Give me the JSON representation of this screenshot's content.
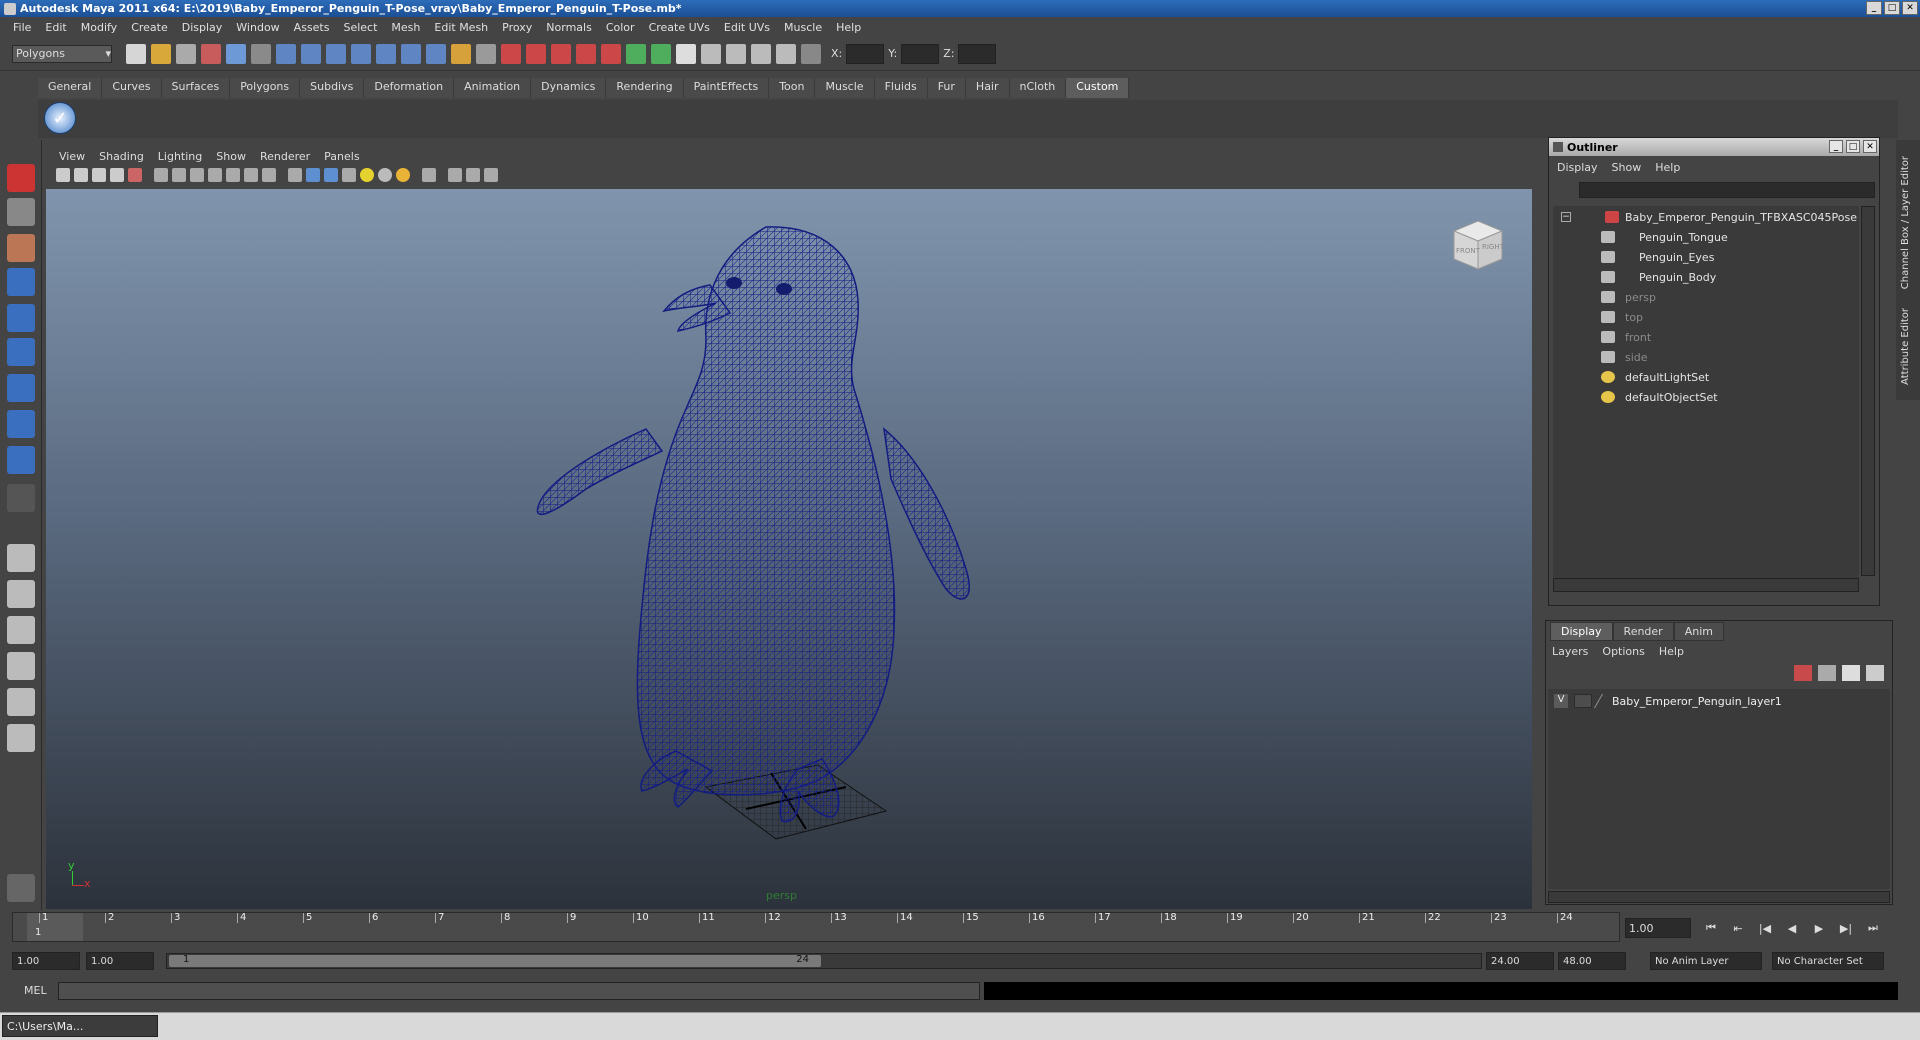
{
  "window": {
    "title": "Autodesk Maya 2011 x64: E:\\2019\\Baby_Emperor_Penguin_T-Pose_vray\\Baby_Emperor_Penguin_T-Pose.mb*"
  },
  "menubar": [
    "File",
    "Edit",
    "Modify",
    "Create",
    "Display",
    "Window",
    "Assets",
    "Select",
    "Mesh",
    "Edit Mesh",
    "Proxy",
    "Normals",
    "Color",
    "Create UVs",
    "Edit UVs",
    "Muscle",
    "Help"
  ],
  "status_line": {
    "mode": "Polygons",
    "coord_labels": {
      "x": "X:",
      "y": "Y:",
      "z": "Z:"
    }
  },
  "shelf_tabs": [
    "General",
    "Curves",
    "Surfaces",
    "Polygons",
    "Subdivs",
    "Deformation",
    "Animation",
    "Dynamics",
    "Rendering",
    "PaintEffects",
    "Toon",
    "Muscle",
    "Fluids",
    "Fur",
    "Hair",
    "nCloth",
    "Custom"
  ],
  "shelf_active": "Custom",
  "viewport": {
    "menu": [
      "View",
      "Shading",
      "Lighting",
      "Show",
      "Renderer",
      "Panels"
    ],
    "camera_label": "persp",
    "viewcube_front": "FRONT",
    "viewcube_right": "RIGHT",
    "axis_y": "y",
    "axis_x": "x"
  },
  "outliner": {
    "title": "Outliner",
    "menu": [
      "Display",
      "Show",
      "Help"
    ],
    "root": "Baby_Emperor_Penguin_TFBXASC045Pose",
    "children": [
      "Penguin_Tongue",
      "Penguin_Eyes",
      "Penguin_Body"
    ],
    "cameras": [
      "persp",
      "top",
      "front",
      "side"
    ],
    "sets": [
      "defaultLightSet",
      "defaultObjectSet"
    ]
  },
  "layer_editor": {
    "tabs": [
      "Display",
      "Render",
      "Anim"
    ],
    "menu": [
      "Layers",
      "Options",
      "Help"
    ],
    "layer_visibility": "V",
    "layer_name": "Baby_Emperor_Penguin_layer1"
  },
  "side_tabs": {
    "channel_box": "Channel Box / Layer Editor",
    "attribute_editor": "Attribute Editor"
  },
  "time_slider": {
    "ticks": [
      "1",
      "2",
      "3",
      "4",
      "5",
      "6",
      "7",
      "8",
      "9",
      "10",
      "11",
      "12",
      "13",
      "14",
      "15",
      "16",
      "17",
      "18",
      "19",
      "20",
      "21",
      "22",
      "23",
      "24"
    ],
    "current_frame_marker": "1",
    "current_time": "1.00"
  },
  "range_slider": {
    "start_time": "1.00",
    "playback_start": "1.00",
    "range_start_label": "1",
    "range_end_label": "24",
    "playback_end": "24.00",
    "end_time": "48.00",
    "anim_layer": "No Anim Layer",
    "character_set": "No Character Set"
  },
  "command_line": {
    "label": "MEL"
  },
  "taskbar": {
    "item": "C:\\Users\\Ma..."
  }
}
